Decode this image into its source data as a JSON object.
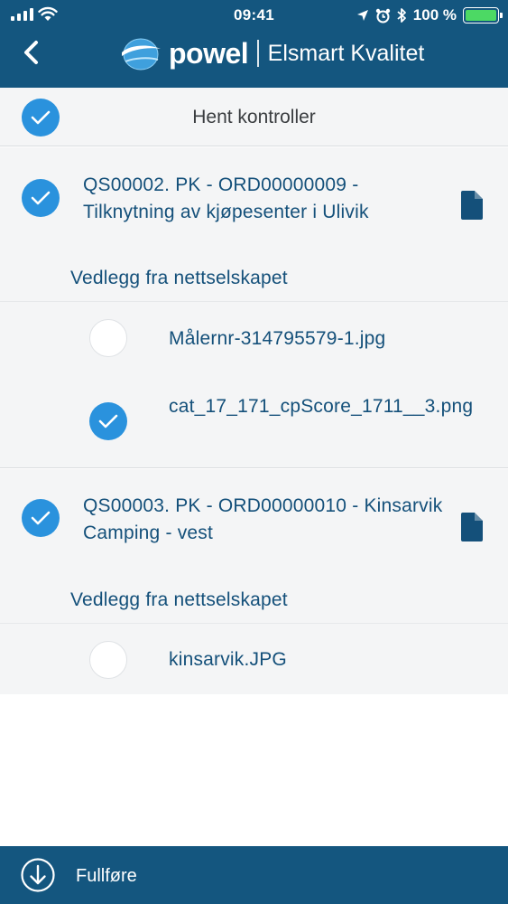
{
  "status_bar": {
    "time": "09:41",
    "battery_percent": "100 %",
    "battery_level": 1.0,
    "icons": [
      "signal-icon",
      "wifi-icon",
      "location-icon",
      "alarm-icon",
      "bluetooth-icon",
      "battery-icon"
    ]
  },
  "nav": {
    "back_icon": "chevron-left-icon",
    "brand": "powel",
    "app_name": "Elsmart Kvalitet"
  },
  "toolbar": {
    "title": "Hent kontroller",
    "select_all_checked": true
  },
  "orders": [
    {
      "checked": true,
      "title": "QS00002. PK - ORD00000009 - Tilknytning av kjøpesenter i Ulivik",
      "attachments_heading": "Vedlegg fra nettselskapet",
      "attachments": [
        {
          "name": "Målernr-314795579-1.jpg",
          "checked": false
        },
        {
          "name": "cat_17_171_cpScore_1711__3.png",
          "checked": true
        }
      ]
    },
    {
      "checked": true,
      "title": "QS00003. PK - ORD00000010 - Kinsarvik Camping - vest",
      "attachments_heading": "Vedlegg fra nettselskapet",
      "attachments": [
        {
          "name": "kinsarvik.JPG",
          "checked": false
        }
      ]
    }
  ],
  "footer": {
    "label": "Fullføre",
    "icon": "download-circle-icon"
  },
  "colors": {
    "header_bg": "#14567f",
    "accent": "#2a92dd",
    "text_primary": "#14507a",
    "panel_bg": "#f4f5f6",
    "battery_green": "#4cd964"
  }
}
